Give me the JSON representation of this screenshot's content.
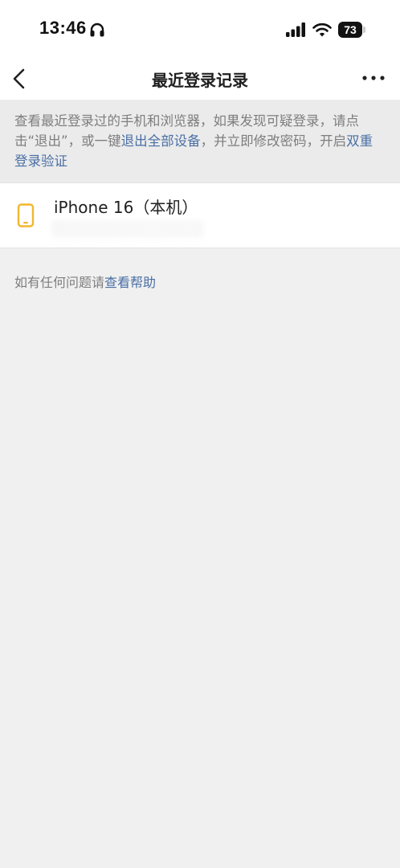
{
  "status_bar": {
    "time": "13:46",
    "battery": "73"
  },
  "nav": {
    "title": "最近登录记录"
  },
  "notice": {
    "part1": "查看最近登录过的手机和浏览器，如果发现可疑登录，请点击“退出”，或一键",
    "link1": "退出全部设备",
    "part2": "，并立即修改密码，开启",
    "link2": "双重登录验证"
  },
  "device": {
    "name": "iPhone 16（本机）",
    "icon": "phone-icon",
    "icon_color": "#f2b72f"
  },
  "help": {
    "prefix": "如有任何问题请",
    "link": "查看帮助"
  },
  "colors": {
    "link": "#4a6fa5",
    "background": "#f0f0f0"
  }
}
